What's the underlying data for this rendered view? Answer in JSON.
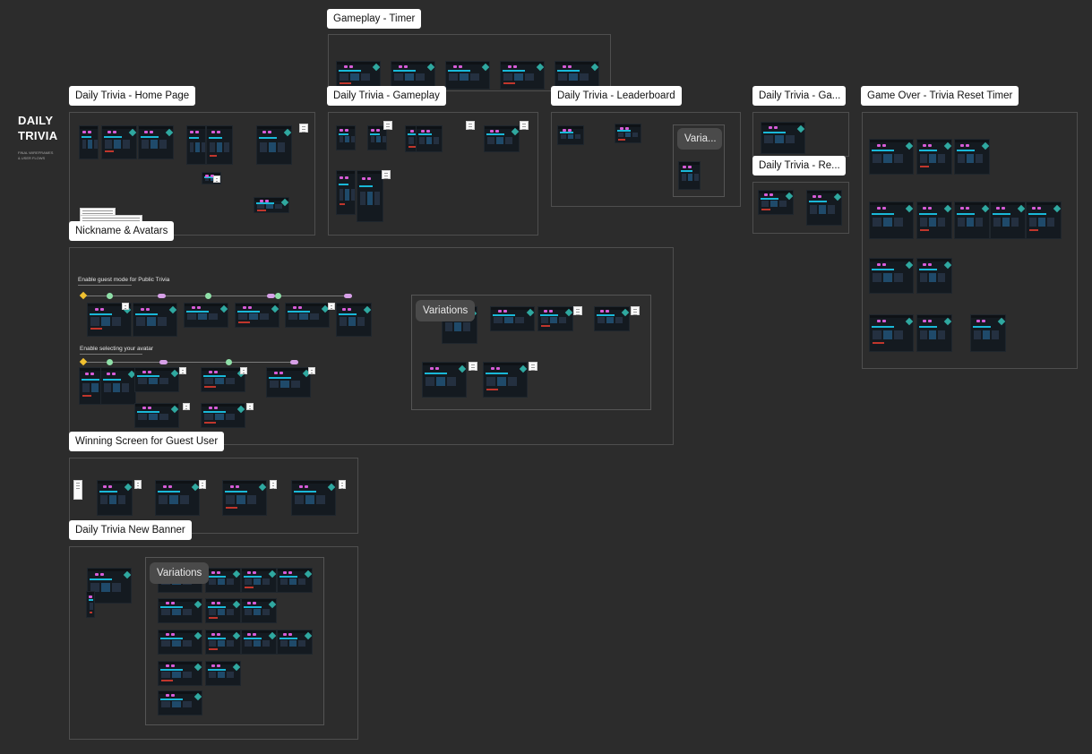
{
  "document": {
    "title_line1": "DAILY",
    "title_line2": "TRIVIA",
    "subtitle_line1": "FINAL WIREFRAMES",
    "subtitle_line2": "& USER FLOWS"
  },
  "sections": {
    "gameplay_timer": "Gameplay - Timer",
    "home_page": "Daily Trivia - Home Page",
    "gameplay": "Daily Trivia - Gameplay",
    "leaderboard": "Daily Trivia - Leaderboard",
    "ga_truncated": "Daily Trivia - Ga...",
    "game_over": "Game Over - Trivia Reset Timer",
    "re_truncated": "Daily Trivia - Re...",
    "nickname": "Nickname & Avatars",
    "winning": "Winning Screen for Guest User",
    "new_banner": "Daily Trivia New Banner"
  },
  "chips": {
    "variations": "Variations",
    "varia_truncated": "Varia..."
  },
  "flows": {
    "guest_mode_title": "Enable guest mode for Public Trivia",
    "avatar_title": "Enable selecting your avatar"
  },
  "colors": {
    "canvas": "#2c2c2c",
    "frame_border": "#4e4e4e",
    "label_bg": "#ffffff",
    "screen_bg": "#141a20",
    "accent_cyan": "#19b8d8",
    "accent_pink": "#d85cd8",
    "gem_teal": "#2fa8a0",
    "flow_green": "#8fe0a8",
    "flow_pink": "#d7a0e8",
    "flow_yellow": "#f0c030"
  }
}
